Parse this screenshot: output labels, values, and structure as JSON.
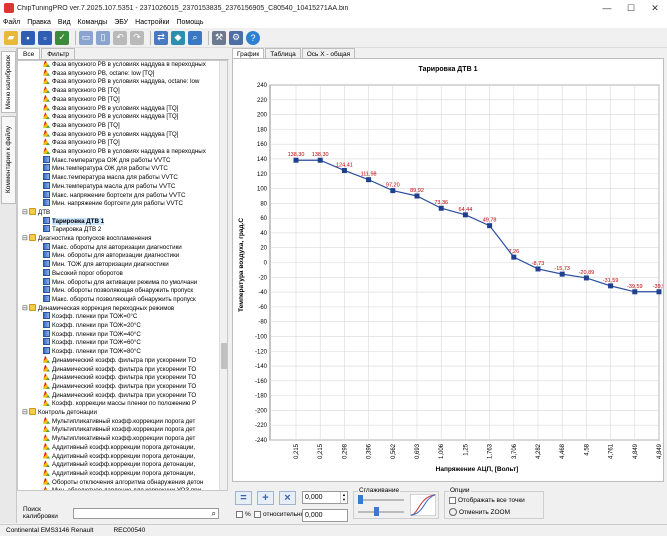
{
  "window": {
    "title": "ChipTuningPRO ver.7.2025.107.5351 - 2371026015_2370153835_2376156905_C80540_10415271AA.bin",
    "buttons": [
      "—",
      "☐",
      "✕"
    ]
  },
  "menu": [
    "Файл",
    "Правка",
    "Вид",
    "Команды",
    "ЭБУ",
    "Настройки",
    "Помощь"
  ],
  "toolbar_icons": [
    "open-folder-icon",
    "save-icon",
    "save-as-icon",
    "checksum-icon",
    "copy-icon",
    "paste-icon",
    "undo-icon",
    "redo-icon",
    "connect-icon",
    "compare-icon",
    "search-icon",
    "tools-icon",
    "settings-icon",
    "help-icon"
  ],
  "side_tabs": [
    "Меню калибровок",
    "Комментарии к файлу"
  ],
  "left_tabs": [
    "Все",
    "Фильтр"
  ],
  "tree": [
    {
      "level": 2,
      "icon": "3d",
      "label": "Фаза впускного РВ в условиях наддува в переходных"
    },
    {
      "level": 2,
      "icon": "3d",
      "label": "Фаза впускного РВ, octane: low  [TQ]"
    },
    {
      "level": 2,
      "icon": "3d",
      "label": "Фаза впускного РВ в условиях наддува, octane: low"
    },
    {
      "level": 2,
      "icon": "3d",
      "label": "Фаза впускного РВ [TQ]"
    },
    {
      "level": 2,
      "icon": "3d",
      "label": "Фаза впускного РВ [TQ]"
    },
    {
      "level": 2,
      "icon": "3d",
      "label": "Фаза впускного РВ в условиях наддува [TQ]"
    },
    {
      "level": 2,
      "icon": "3d",
      "label": "Фаза впускного РВ в условиях наддува [TQ]"
    },
    {
      "level": 2,
      "icon": "3d",
      "label": "Фаза впускного РВ [TQ]"
    },
    {
      "level": 2,
      "icon": "3d",
      "label": "Фаза впускного РВ в условиях наддува [TQ]"
    },
    {
      "level": 2,
      "icon": "3d",
      "label": "Фаза впускного РВ [TQ]"
    },
    {
      "level": 2,
      "icon": "3d",
      "label": "Фаза впускного РВ в условиях наддува в переходных"
    },
    {
      "level": 2,
      "icon": "2d",
      "label": "Макс.температура ОЖ для работы VVTC"
    },
    {
      "level": 2,
      "icon": "2d",
      "label": "Мин.температура ОЖ для работы VVTC"
    },
    {
      "level": 2,
      "icon": "2d",
      "label": "Макс.температура масла для работы VVTC"
    },
    {
      "level": 2,
      "icon": "2d",
      "label": "Мин.температура масла для работы VVTC"
    },
    {
      "level": 2,
      "icon": "2d",
      "label": "Макс. напряжение бортсети для работы VVTC"
    },
    {
      "level": 2,
      "icon": "2d",
      "label": "Мин. напряжение бортсети для работы VVTC"
    },
    {
      "level": 1,
      "icon": "folder",
      "expander": "⊟",
      "label": "ДТВ"
    },
    {
      "level": 2,
      "icon": "2d",
      "label": "Тарировка ДТВ 1",
      "selected": true
    },
    {
      "level": 2,
      "icon": "2d",
      "label": "Тарировка ДТВ 2"
    },
    {
      "level": 1,
      "icon": "folder",
      "expander": "⊟",
      "label": "Диагностика пропусков воспламенения"
    },
    {
      "level": 2,
      "icon": "2d",
      "label": "Макс. обороты для авторизации диагностики"
    },
    {
      "level": 2,
      "icon": "2d",
      "label": "Мин. обороты для авторизации диагностики"
    },
    {
      "level": 2,
      "icon": "2d",
      "label": "Мин. ТОЖ для авторизации диагностики"
    },
    {
      "level": 2,
      "icon": "2d",
      "label": "Высокий порог оборотов"
    },
    {
      "level": 2,
      "icon": "2d",
      "label": "Мин. обороты для активации режима по умолчани"
    },
    {
      "level": 2,
      "icon": "2d",
      "label": "Мин. обороты  позволяющая обнаружить пропуск"
    },
    {
      "level": 2,
      "icon": "2d",
      "label": "Макс. обороты позволяющий обнаружить пропуск"
    },
    {
      "level": 1,
      "icon": "folder",
      "expander": "⊟",
      "label": "Динамическая коррекция переходных режимов"
    },
    {
      "level": 2,
      "icon": "2d",
      "label": "Коэфф. пленки при ТОЖ=0°С"
    },
    {
      "level": 2,
      "icon": "2d",
      "label": "Коэфф. пленки при ТОЖ=20°С"
    },
    {
      "level": 2,
      "icon": "2d",
      "label": "Коэфф. пленки при ТОЖ=40°С"
    },
    {
      "level": 2,
      "icon": "2d",
      "label": "Коэфф. пленки при ТОЖ=60°С"
    },
    {
      "level": 2,
      "icon": "2d",
      "label": "Коэфф. пленки при ТОЖ=80°С"
    },
    {
      "level": 2,
      "icon": "3d",
      "label": "Динамический коэфф. фильтра при ускорении ТО"
    },
    {
      "level": 2,
      "icon": "3d",
      "label": "Динамический коэфф. фильтра при ускорении ТО"
    },
    {
      "level": 2,
      "icon": "3d",
      "label": "Динамический коэфф. фильтра при ускорении ТО"
    },
    {
      "level": 2,
      "icon": "3d",
      "label": "Динамический коэфф. фильтра при ускорении ТО"
    },
    {
      "level": 2,
      "icon": "3d",
      "label": "Динамический коэфф. фильтра при ускорении ТО"
    },
    {
      "level": 2,
      "icon": "3d",
      "label": "Коэфф. коррекции массы пленки по положению Р"
    },
    {
      "level": 1,
      "icon": "folder",
      "expander": "⊟",
      "label": "Контроль детонации"
    },
    {
      "level": 2,
      "icon": "3d",
      "label": "Мультипликативный коэфф.коррекции порога дет"
    },
    {
      "level": 2,
      "icon": "3d",
      "label": "Мультипликативный коэфф.коррекции порога дет"
    },
    {
      "level": 2,
      "icon": "3d",
      "label": "Мультипликативный коэфф.коррекции порога дет"
    },
    {
      "level": 2,
      "icon": "3d",
      "label": "Аддитивный коэфф.коррекции порога детонации,"
    },
    {
      "level": 2,
      "icon": "3d",
      "label": "Аддитивный коэфф.коррекции порога детонации,"
    },
    {
      "level": 2,
      "icon": "3d",
      "label": "Аддитивный коэфф.коррекции порога детонации,"
    },
    {
      "level": 2,
      "icon": "3d",
      "label": "Аддитивный коэфф.коррекции порога детонации,"
    },
    {
      "level": 2,
      "icon": "3d",
      "label": "Обороты отключения алгоритма обнаружения детон"
    },
    {
      "level": 2,
      "icon": "3d",
      "label": "Мин. абсолютное давление для коррекции УОЗ при"
    }
  ],
  "search": {
    "label": "Поиск калибровки",
    "value": ""
  },
  "right_tabs": [
    "График",
    "Таблица",
    "Ось X - общая"
  ],
  "chart_data": {
    "type": "line",
    "title": "Тарировка ДТВ 1",
    "xlabel": "Напряжение АЦП, [Вольт]",
    "ylabel": "Температура воздуха, град.С",
    "categories": [
      "0,215",
      "0,215",
      "0,298",
      "0,396",
      "0,562",
      "0,693",
      "1,006",
      "1,25",
      "1,763",
      "3,706",
      "4,282",
      "4,468",
      "4,58",
      "4,761",
      "4,849",
      "4,849"
    ],
    "values": [
      138.3,
      138.3,
      124.41,
      111.98,
      97.2,
      89.92,
      73.36,
      64.44,
      49.78,
      7.26,
      -8.73,
      -15.73,
      -20.89,
      -31.59,
      -39.59,
      -39.59
    ],
    "point_labels": [
      "138,30",
      "138,30",
      "124,41",
      "111,98",
      "97,20",
      "89,92",
      "73,36",
      "64,44",
      "49,78",
      "7,26",
      "-8,73",
      "-15,73",
      "-20,89",
      "-31,59",
      "-39,59",
      "-39,5"
    ],
    "ylim": [
      -240,
      240
    ],
    "yticks": [
      240,
      220,
      200,
      180,
      160,
      140,
      120,
      100,
      80,
      60,
      40,
      20,
      0,
      -20,
      -40,
      -60,
      -80,
      -100,
      -120,
      -140,
      -160,
      -180,
      -200,
      -220,
      -240
    ],
    "grid": true,
    "line_color": "#2b4f9e",
    "marker_color": "#1f3f8f",
    "label_color": "#c00000"
  },
  "bottom": {
    "value1": "0,000",
    "value2": "0,000",
    "percent_label": "%",
    "relative_label": "относительно",
    "smoothing_label": "Сглаживание",
    "options_label": "Опции",
    "show_all_points_label": "Отображать все точки",
    "cancel_zoom_label": "Отменить ZOOM"
  },
  "status": [
    "Continental EMS3146 Renault",
    "REC00540"
  ]
}
